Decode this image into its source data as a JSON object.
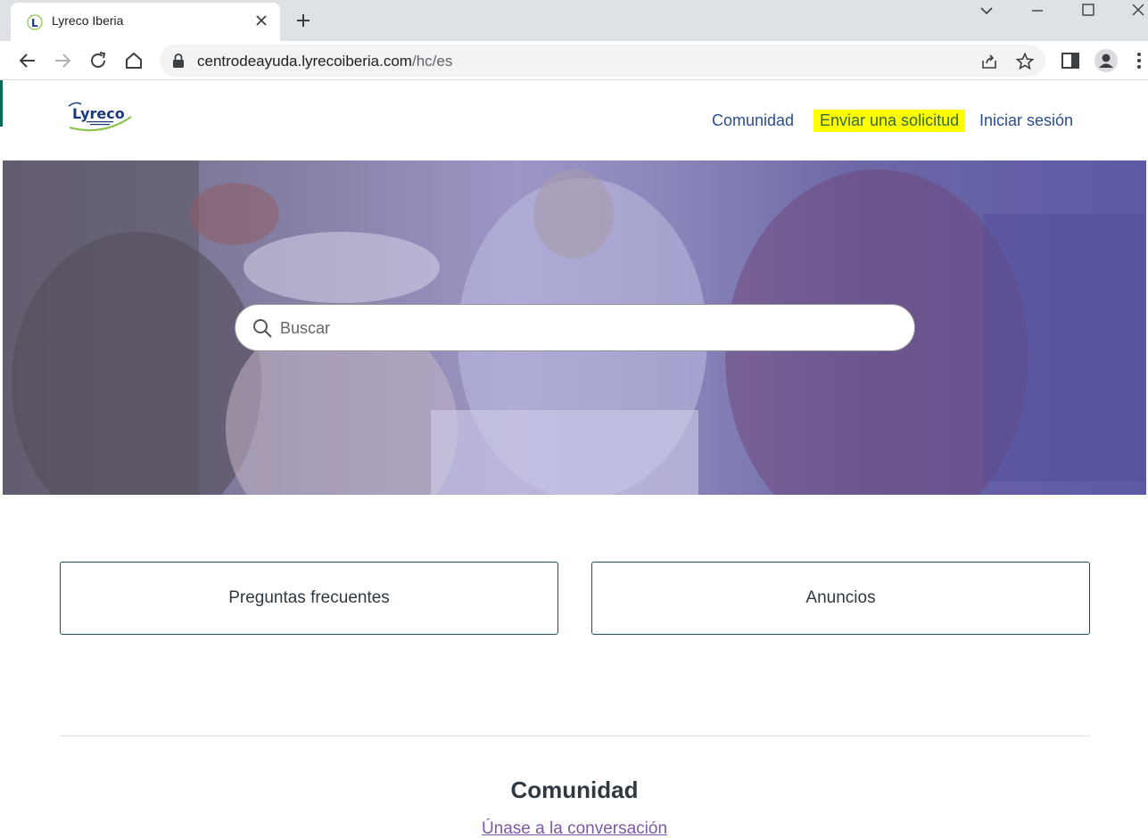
{
  "browser": {
    "tab_title": "Lyreco Iberia",
    "url_host": "centrodeayuda.lyrecoiberia.com",
    "url_path": "/hc/es"
  },
  "header": {
    "logo_text": "Lyreco",
    "nav": [
      "Comunidad",
      "Enviar una solicitud",
      "Iniciar sesión"
    ],
    "highlight_color": "#ffff00"
  },
  "hero": {
    "search_placeholder": "Buscar"
  },
  "categories": [
    "Preguntas frecuentes",
    "Anuncios"
  ],
  "community": {
    "title": "Comunidad",
    "link": "Únase a la conversación"
  },
  "colors": {
    "nav_link": "#2a4d8f",
    "card_border": "#1f4f5a",
    "community_link": "#7b5aa6"
  }
}
